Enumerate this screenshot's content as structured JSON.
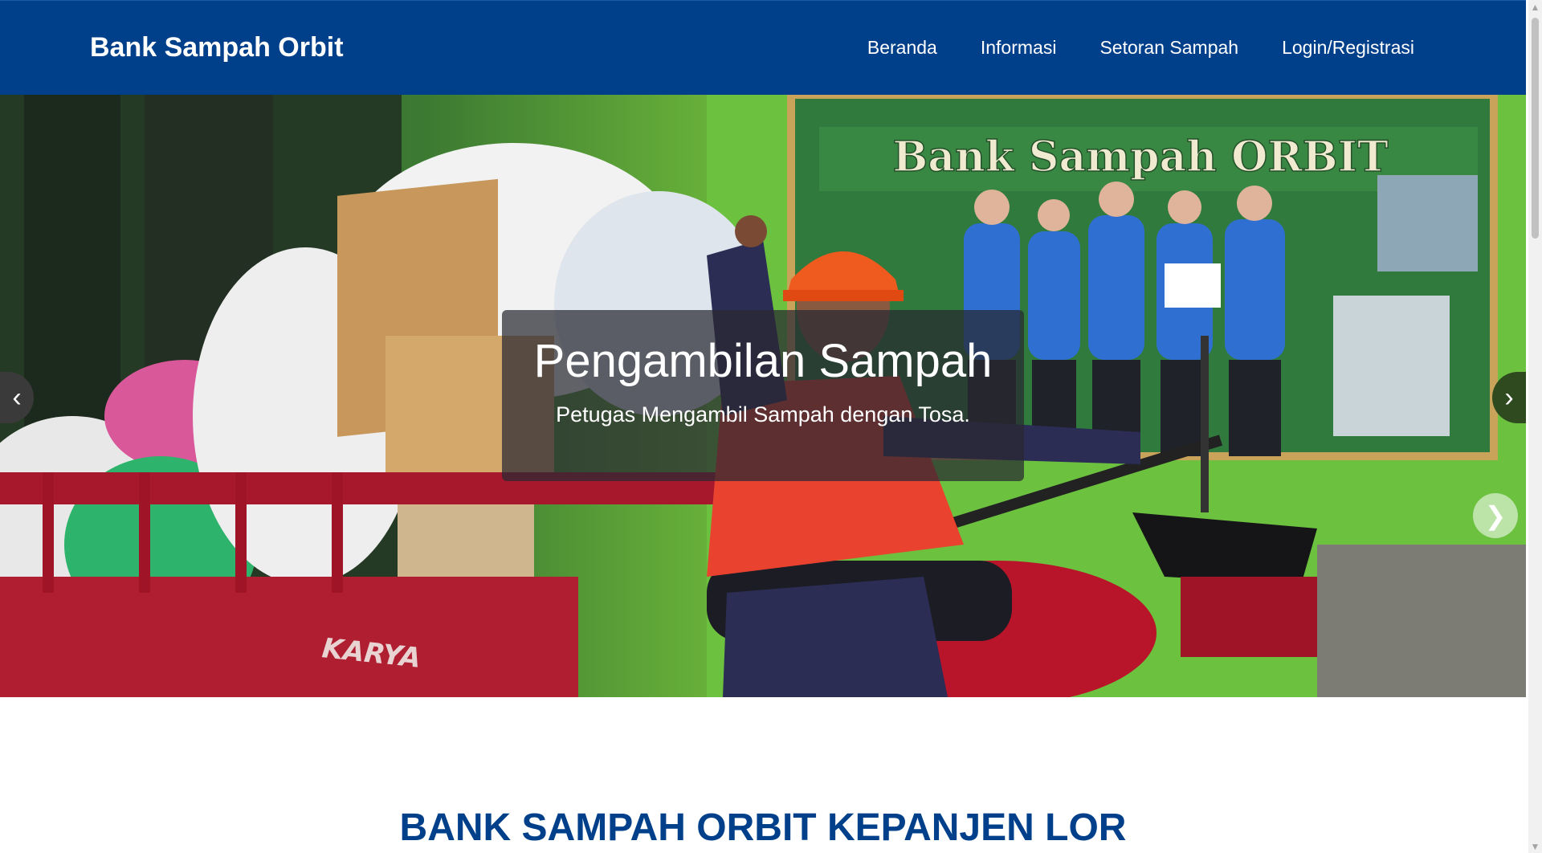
{
  "navbar": {
    "brand": "Bank Sampah Orbit",
    "links": [
      {
        "label": "Beranda"
      },
      {
        "label": "Informasi"
      },
      {
        "label": "Setoran Sampah"
      },
      {
        "label": "Login/Registrasi"
      }
    ]
  },
  "hero": {
    "caption_title": "Pengambilan Sampah",
    "caption_text": "Petugas Mengambil Sampah dengan Tosa.",
    "banner_text": "Bank Sampah ORBIT",
    "vehicle_brand": "KARYA",
    "prev_icon": "‹",
    "next_icon": "›",
    "next2_icon": "❯"
  },
  "section": {
    "title": "BANK SAMPAH ORBIT KEPANJEN LOR"
  },
  "colors": {
    "navbar": "#003f8a",
    "title": "#003f8a"
  },
  "scrollbar": {
    "up_icon": "▲",
    "down_icon": "▼"
  }
}
